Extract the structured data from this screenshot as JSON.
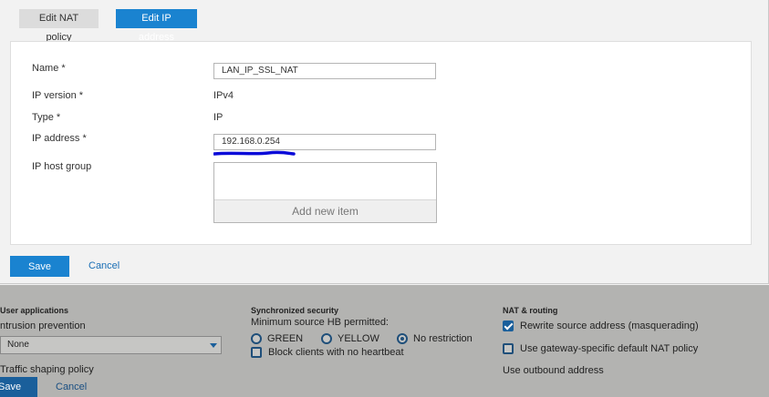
{
  "tabs": {
    "edit_nat_policy": "Edit NAT policy",
    "edit_ip_address": "Edit IP address"
  },
  "form": {
    "name_label": "Name *",
    "name_value": "LAN_IP_SSL_NAT",
    "ip_version_label": "IP version *",
    "ip_version_value": "IPv4",
    "type_label": "Type *",
    "type_value": "IP",
    "ip_address_label": "IP address *",
    "ip_address_value": "192.168.0.254",
    "ip_host_group_label": "IP host group",
    "add_new_item": "Add new item"
  },
  "actions": {
    "save": "Save",
    "cancel": "Cancel"
  },
  "background": {
    "user_applications_heading": "User applications",
    "intrusion_prevention_label": "ntrusion prevention",
    "intrusion_prevention_value": "None",
    "traffic_shaping_label": "Traffic shaping policy",
    "sync_security_heading": "Synchronized security",
    "min_source_hb_label": "Minimum source HB permitted:",
    "radio_green": "GREEN",
    "radio_yellow": "YELLOW",
    "radio_no_restriction": "No restriction",
    "block_clients_label": "Block clients with no heartbeat",
    "nat_routing_heading": "NAT & routing",
    "rewrite_source_label": "Rewrite source address (masquerading)",
    "gateway_specific_label": "Use gateway-specific default NAT policy",
    "outbound_address_label": "Use outbound address",
    "save": "Save",
    "cancel": "Cancel"
  },
  "colors": {
    "accent": "#1a83d0",
    "annotation_underline": "#0a0ad8"
  }
}
